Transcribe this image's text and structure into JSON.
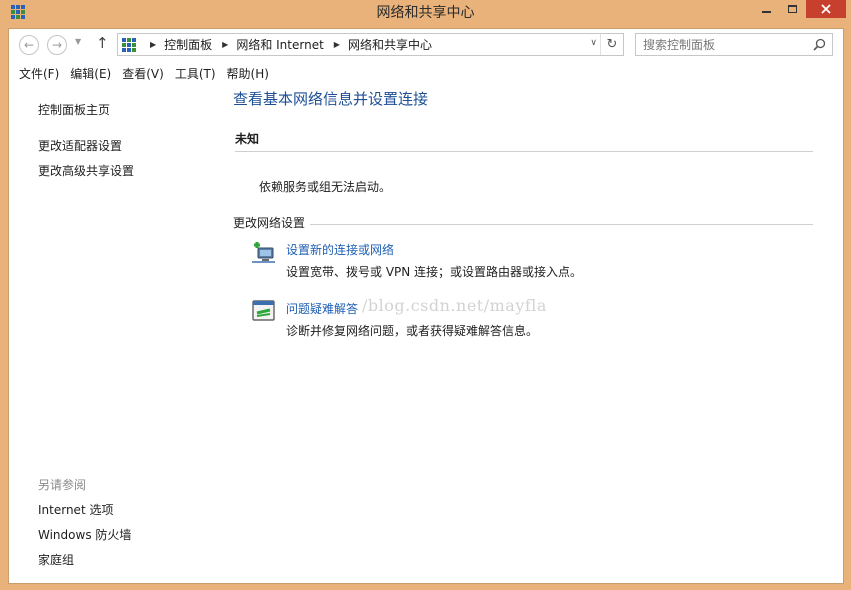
{
  "window": {
    "title": "网络和共享中心"
  },
  "address_bar": {
    "crumbs": [
      "控制面板",
      "网络和 Internet",
      "网络和共享中心"
    ]
  },
  "search": {
    "placeholder": "搜索控制面板"
  },
  "menu": {
    "items": [
      "文件(F)",
      "编辑(E)",
      "查看(V)",
      "工具(T)",
      "帮助(H)"
    ]
  },
  "sidebar": {
    "home": "控制面板主页",
    "links": [
      "更改适配器设置",
      "更改高级共享设置"
    ],
    "see_also_heading": "另请参阅",
    "see_also": [
      "Internet 选项",
      "Windows 防火墙",
      "家庭组"
    ]
  },
  "main": {
    "title": "查看基本网络信息并设置连接",
    "network_name": "未知",
    "network_status": "依赖服务或组无法启动。",
    "section_title": "更改网络设置",
    "tasks": [
      {
        "link": "设置新的连接或网络",
        "desc": "设置宽带、拨号或 VPN 连接；或设置路由器或接入点。"
      },
      {
        "link": "问题疑难解答",
        "desc": "诊断并修复网络问题，或者获得疑难解答信息。"
      }
    ]
  },
  "watermark": "/blog.csdn.net/mayfla",
  "colors": {
    "frame": "#e8b27a",
    "link": "#1e5fb4",
    "heading": "#1e4f95",
    "close_button": "#c7402e"
  }
}
